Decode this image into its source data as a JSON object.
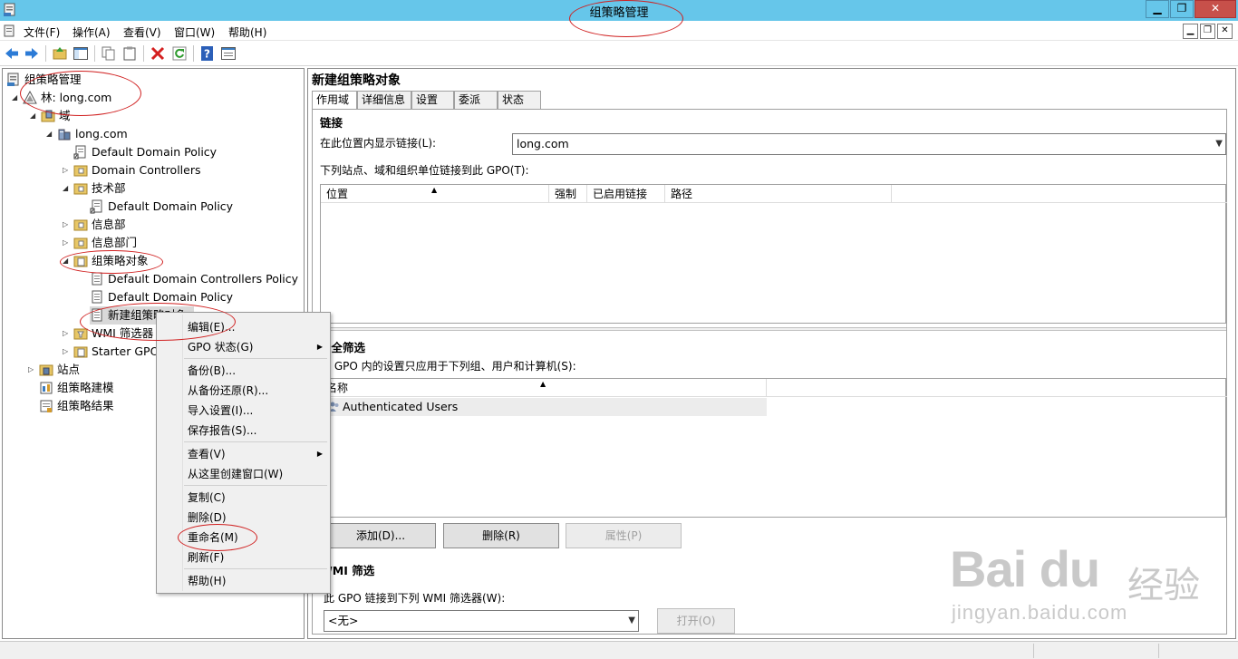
{
  "window": {
    "title": "组策略管理",
    "min": "▁",
    "restore": "❐",
    "close": "✕"
  },
  "colors": {
    "titlebar": "#66c6ea",
    "annotation": "#d02020",
    "close": "#c7504a"
  },
  "menu": [
    "文件(F)",
    "操作(A)",
    "查看(V)",
    "窗口(W)",
    "帮助(H)"
  ],
  "toolbar_icons": [
    "back-arrow-icon",
    "forward-arrow-icon",
    "up-folder-icon",
    "show-tree-icon",
    "copy-icon",
    "paste-icon",
    "delete-icon",
    "refresh-icon",
    "help-icon",
    "properties-icon"
  ],
  "tree": [
    {
      "label": "组策略管理",
      "icon": "gpm-root-icon",
      "expander": ""
    },
    {
      "label": "林: long.com",
      "icon": "forest-icon",
      "expander": "◢"
    },
    {
      "label": "域",
      "icon": "domains-folder-icon",
      "expander": "◢"
    },
    {
      "label": "long.com",
      "icon": "domain-icon",
      "expander": "◢"
    },
    {
      "label": "Default Domain Policy",
      "icon": "gpo-link-icon",
      "expander": ""
    },
    {
      "label": "Domain Controllers",
      "icon": "ou-folder-icon",
      "expander": "▷"
    },
    {
      "label": "技术部",
      "icon": "ou-folder-icon",
      "expander": "◢"
    },
    {
      "label": "Default Domain Policy",
      "icon": "gpo-link-icon",
      "expander": ""
    },
    {
      "label": "信息部",
      "icon": "ou-folder-icon",
      "expander": "▷"
    },
    {
      "label": "信息部门",
      "icon": "ou-folder-icon",
      "expander": "▷"
    },
    {
      "label": "组策略对象",
      "icon": "gpo-folder-icon",
      "expander": "◢"
    },
    {
      "label": "Default Domain Controllers Policy",
      "icon": "gpo-icon",
      "expander": ""
    },
    {
      "label": "Default Domain Policy",
      "icon": "gpo-icon",
      "expander": ""
    },
    {
      "label": "新建组策略对象",
      "icon": "gpo-icon",
      "expander": ""
    },
    {
      "label": "WMI 筛选器",
      "icon": "wmi-folder-icon",
      "expander": "▷"
    },
    {
      "label": "Starter GPO",
      "icon": "starter-folder-icon",
      "expander": "▷"
    },
    {
      "label": "站点",
      "icon": "sites-icon",
      "expander": "▷"
    },
    {
      "label": "组策略建模",
      "icon": "modeling-icon",
      "expander": ""
    },
    {
      "label": "组策略结果",
      "icon": "results-icon",
      "expander": ""
    }
  ],
  "right": {
    "title": "新建组策略对象",
    "tabs": [
      "作用域",
      "详细信息",
      "设置",
      "委派",
      "状态"
    ],
    "links": {
      "heading": "链接",
      "show_label": "在此位置内显示链接(L):",
      "location_value": "long.com",
      "list_label": "下列站点、域和组织单位链接到此 GPO(T):",
      "columns": [
        "位置",
        "强制",
        "已启用链接",
        "路径"
      ]
    },
    "security": {
      "heading": "安全筛选",
      "desc": "此 GPO 内的设置只应用于下列组、用户和计算机(S):",
      "column": "名称",
      "row": "Authenticated Users",
      "add": "添加(D)...",
      "remove": "删除(R)",
      "props": "属性(P)"
    },
    "wmi": {
      "heading": "WMI 筛选",
      "desc": "此 GPO 链接到下列 WMI 筛选器(W):",
      "value": "<无>",
      "open": "打开(O)"
    }
  },
  "context_menu": [
    {
      "label": "编辑(E)...",
      "submenu": false
    },
    {
      "label": "GPO 状态(G)",
      "submenu": true
    },
    {
      "label": "备份(B)...",
      "submenu": false
    },
    {
      "label": "从备份还原(R)...",
      "submenu": false
    },
    {
      "label": "导入设置(I)...",
      "submenu": false
    },
    {
      "label": "保存报告(S)...",
      "submenu": false
    },
    {
      "label": "查看(V)",
      "submenu": true
    },
    {
      "label": "从这里创建窗口(W)",
      "submenu": false
    },
    {
      "label": "复制(C)",
      "submenu": false
    },
    {
      "label": "删除(D)",
      "submenu": false
    },
    {
      "label": "重命名(M)",
      "submenu": false
    },
    {
      "label": "刷新(F)",
      "submenu": false
    },
    {
      "label": "帮助(H)",
      "submenu": false
    }
  ],
  "watermark": {
    "main": "Bai du",
    "cn": "经验",
    "sub": "jingyan.baidu.com"
  }
}
